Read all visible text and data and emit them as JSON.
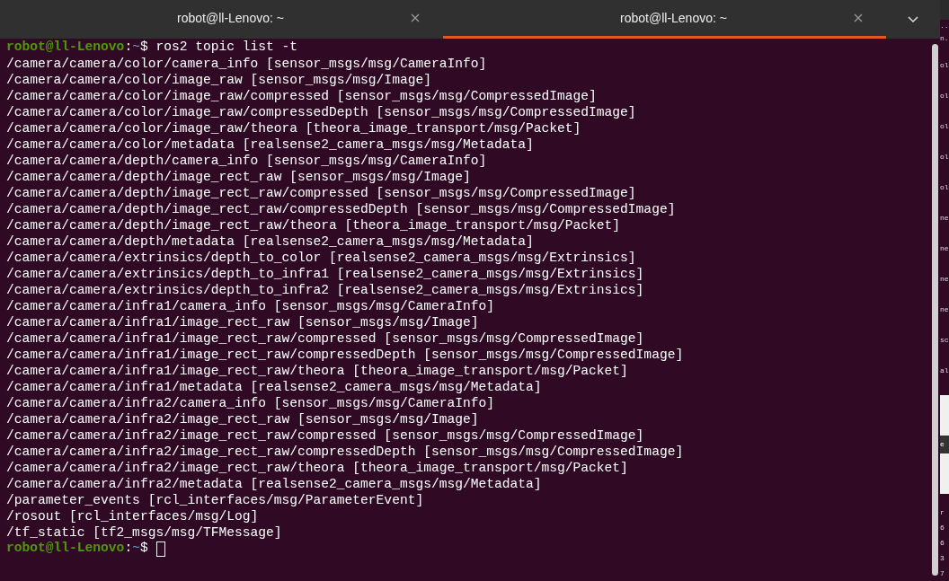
{
  "tabs": [
    {
      "title": "robot@ll-Lenovo: ~",
      "selected": false
    },
    {
      "title": "robot@ll-Lenovo: ~",
      "selected": true
    }
  ],
  "terminal": {
    "lines": [
      {
        "kind": "prompt",
        "user": "robot@ll-Lenovo",
        "separator": ":",
        "path": "~",
        "symbol": "$",
        "command": "ros2 topic list -t",
        "cursor": false
      },
      {
        "kind": "output",
        "text": "/camera/camera/color/camera_info [sensor_msgs/msg/CameraInfo]"
      },
      {
        "kind": "output",
        "text": "/camera/camera/color/image_raw [sensor_msgs/msg/Image]"
      },
      {
        "kind": "output",
        "text": "/camera/camera/color/image_raw/compressed [sensor_msgs/msg/CompressedImage]"
      },
      {
        "kind": "output",
        "text": "/camera/camera/color/image_raw/compressedDepth [sensor_msgs/msg/CompressedImage]"
      },
      {
        "kind": "output",
        "text": "/camera/camera/color/image_raw/theora [theora_image_transport/msg/Packet]"
      },
      {
        "kind": "output",
        "text": "/camera/camera/color/metadata [realsense2_camera_msgs/msg/Metadata]"
      },
      {
        "kind": "output",
        "text": "/camera/camera/depth/camera_info [sensor_msgs/msg/CameraInfo]"
      },
      {
        "kind": "output",
        "text": "/camera/camera/depth/image_rect_raw [sensor_msgs/msg/Image]"
      },
      {
        "kind": "output",
        "text": "/camera/camera/depth/image_rect_raw/compressed [sensor_msgs/msg/CompressedImage]"
      },
      {
        "kind": "output",
        "text": "/camera/camera/depth/image_rect_raw/compressedDepth [sensor_msgs/msg/CompressedImage]"
      },
      {
        "kind": "output",
        "text": "/camera/camera/depth/image_rect_raw/theora [theora_image_transport/msg/Packet]"
      },
      {
        "kind": "output",
        "text": "/camera/camera/depth/metadata [realsense2_camera_msgs/msg/Metadata]"
      },
      {
        "kind": "output",
        "text": "/camera/camera/extrinsics/depth_to_color [realsense2_camera_msgs/msg/Extrinsics]"
      },
      {
        "kind": "output",
        "text": "/camera/camera/extrinsics/depth_to_infra1 [realsense2_camera_msgs/msg/Extrinsics]"
      },
      {
        "kind": "output",
        "text": "/camera/camera/extrinsics/depth_to_infra2 [realsense2_camera_msgs/msg/Extrinsics]"
      },
      {
        "kind": "output",
        "text": "/camera/camera/infra1/camera_info [sensor_msgs/msg/CameraInfo]"
      },
      {
        "kind": "output",
        "text": "/camera/camera/infra1/image_rect_raw [sensor_msgs/msg/Image]"
      },
      {
        "kind": "output",
        "text": "/camera/camera/infra1/image_rect_raw/compressed [sensor_msgs/msg/CompressedImage]"
      },
      {
        "kind": "output",
        "text": "/camera/camera/infra1/image_rect_raw/compressedDepth [sensor_msgs/msg/CompressedImage]"
      },
      {
        "kind": "output",
        "text": "/camera/camera/infra1/image_rect_raw/theora [theora_image_transport/msg/Packet]"
      },
      {
        "kind": "output",
        "text": "/camera/camera/infra1/metadata [realsense2_camera_msgs/msg/Metadata]"
      },
      {
        "kind": "output",
        "text": "/camera/camera/infra2/camera_info [sensor_msgs/msg/CameraInfo]"
      },
      {
        "kind": "output",
        "text": "/camera/camera/infra2/image_rect_raw [sensor_msgs/msg/Image]"
      },
      {
        "kind": "output",
        "text": "/camera/camera/infra2/image_rect_raw/compressed [sensor_msgs/msg/CompressedImage]"
      },
      {
        "kind": "output",
        "text": "/camera/camera/infra2/image_rect_raw/compressedDepth [sensor_msgs/msg/CompressedImage]"
      },
      {
        "kind": "output",
        "text": "/camera/camera/infra2/image_rect_raw/theora [theora_image_transport/msg/Packet]"
      },
      {
        "kind": "output",
        "text": "/camera/camera/infra2/metadata [realsense2_camera_msgs/msg/Metadata]"
      },
      {
        "kind": "output",
        "text": "/parameter_events [rcl_interfaces/msg/ParameterEvent]"
      },
      {
        "kind": "output",
        "text": "/rosout [rcl_interfaces/msg/Log]"
      },
      {
        "kind": "output",
        "text": "/tf_static [tf2_msgs/msg/TFMessage]"
      },
      {
        "kind": "prompt",
        "user": "robot@ll-Lenovo",
        "separator": ":",
        "path": "~",
        "symbol": "$",
        "cursor": true
      }
    ]
  },
  "background_window": {
    "top_lines": [
      "..",
      "n."
    ],
    "upper_lines": [
      "ol",
      "ol",
      "ol",
      "ol",
      "ol",
      "ne",
      "ne",
      "ne",
      "ne",
      "sc",
      "al"
    ],
    "panel_text": "e",
    "lower_lines": [
      "r",
      "6",
      "6",
      "3",
      "7"
    ]
  }
}
